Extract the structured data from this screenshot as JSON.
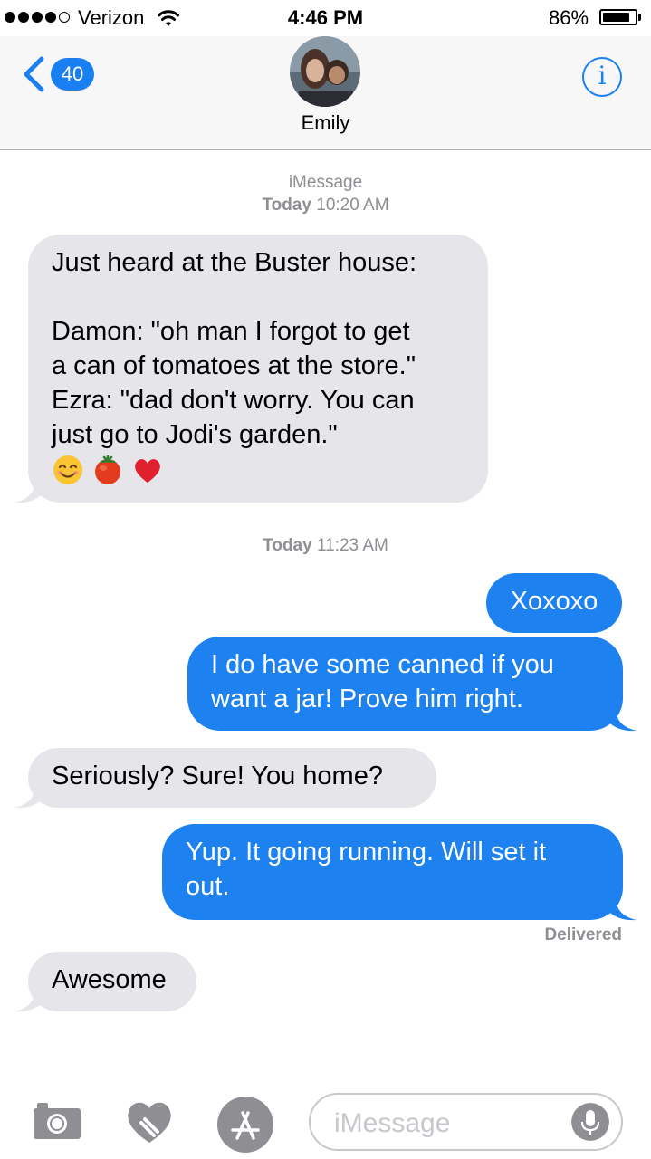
{
  "status_bar": {
    "carrier": "Verizon",
    "time": "4:46 PM",
    "battery_percent": "86%",
    "signal_bars_filled": 4,
    "signal_bars_total": 5,
    "battery_level": 0.86
  },
  "header": {
    "back_icon": "chevron-left-icon",
    "unread_count": "40",
    "contact_name": "Emily",
    "info_icon": "info-icon",
    "info_glyph": "i"
  },
  "thread": {
    "service": "iMessage",
    "sections": [
      {
        "day": "Today",
        "time": "10:20 AM"
      },
      {
        "day": "Today",
        "time": "11:23 AM"
      }
    ],
    "messages": [
      {
        "direction": "received",
        "lines": [
          "Just heard at the Buster house:",
          "",
          "Damon: \"oh man I forgot to get",
          "a can of tomatoes at the store.\"",
          "Ezra: \"dad don't worry. You can",
          "just go to Jodi's garden.\""
        ],
        "emoji": [
          "smiling-face-icon",
          "tomato-icon",
          "red-heart-icon"
        ]
      },
      {
        "direction": "sent",
        "lines": [
          "Xoxoxo"
        ]
      },
      {
        "direction": "sent",
        "lines": [
          "I do have some canned if you",
          "want a jar! Prove him right."
        ]
      },
      {
        "direction": "received",
        "lines": [
          "Seriously? Sure! You home?"
        ]
      },
      {
        "direction": "sent",
        "lines": [
          "Yup.  It going running. Will set it",
          "out."
        ]
      },
      {
        "direction": "received",
        "lines": [
          "Awesome"
        ]
      }
    ],
    "delivered_label": "Delivered"
  },
  "input_bar": {
    "camera_icon": "camera-icon",
    "digital_touch_icon": "heart-touch-icon",
    "app_store_icon": "app-store-icon",
    "placeholder": "iMessage",
    "value": "",
    "mic_icon": "microphone-icon"
  },
  "colors": {
    "accent": "#1a7ff0",
    "sent_bubble": "#1d82f0",
    "received_bubble": "#e5e5ea",
    "secondary_text": "#8e8e93"
  }
}
